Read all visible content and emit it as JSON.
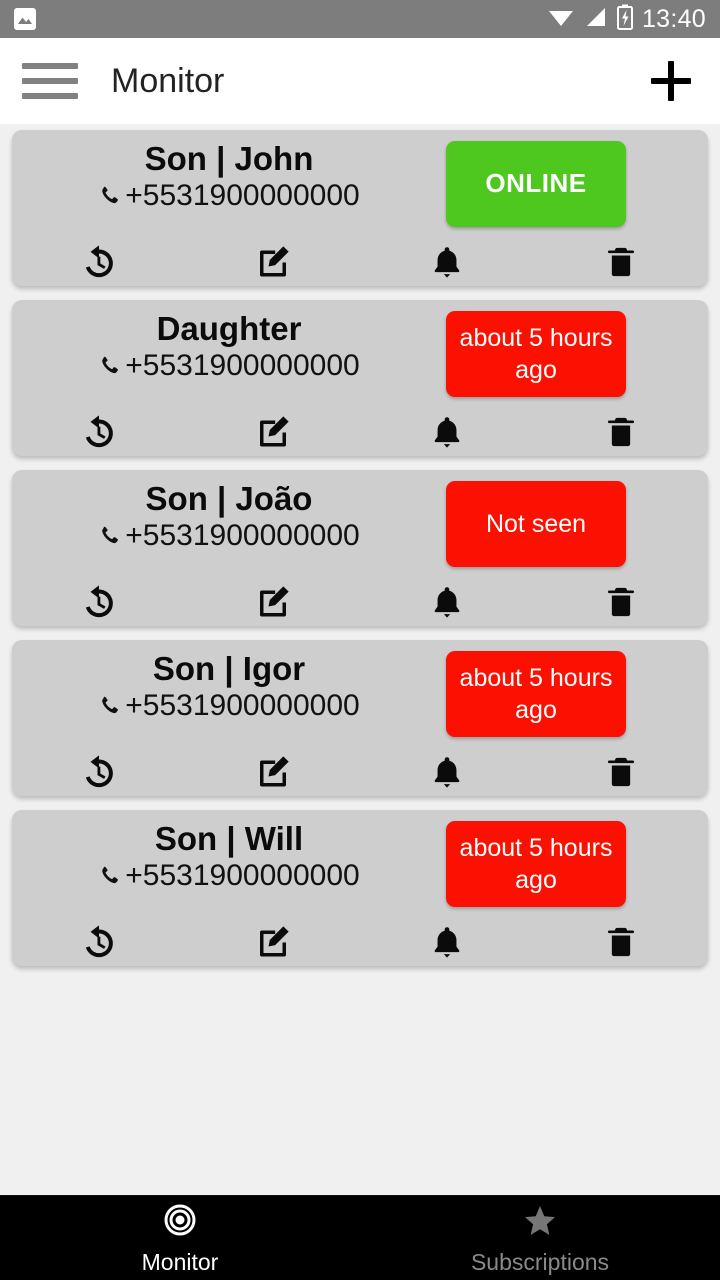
{
  "statusbar": {
    "notification_icon": "image-icon",
    "wifi_icon": "wifi-icon",
    "signal_icon": "cellular-signal-icon",
    "battery_icon": "battery-charging-icon",
    "time": "13:40"
  },
  "appbar": {
    "menu_icon": "hamburger-menu-icon",
    "title": "Monitor",
    "add_icon": "plus-icon"
  },
  "actions": {
    "history_label": "history-icon",
    "edit_label": "edit-icon",
    "bell_label": "bell-icon",
    "delete_label": "trash-icon"
  },
  "colors": {
    "online": "#4ec81e",
    "offline": "#fb1001",
    "card": "#cecece",
    "background": "#f0f0f0",
    "statusbar": "#7d7d7d"
  },
  "contacts": [
    {
      "name": "Son | John",
      "phone": "+5531900000000",
      "status": "ONLINE",
      "status_type": "online"
    },
    {
      "name": "Daughter",
      "phone": "+5531900000000",
      "status": "about 5 hours ago",
      "status_type": "offline"
    },
    {
      "name": "Son | João",
      "phone": "+5531900000000",
      "status": "Not seen",
      "status_type": "offline"
    },
    {
      "name": "Son | Igor",
      "phone": "+5531900000000",
      "status": "about 5 hours ago",
      "status_type": "offline"
    },
    {
      "name": "Son | Will",
      "phone": "+5531900000000",
      "status": "about 5 hours ago",
      "status_type": "offline"
    }
  ],
  "bottomnav": [
    {
      "label": "Monitor",
      "icon": "target-icon",
      "active": true
    },
    {
      "label": "Subscriptions",
      "icon": "star-icon",
      "active": false
    }
  ]
}
